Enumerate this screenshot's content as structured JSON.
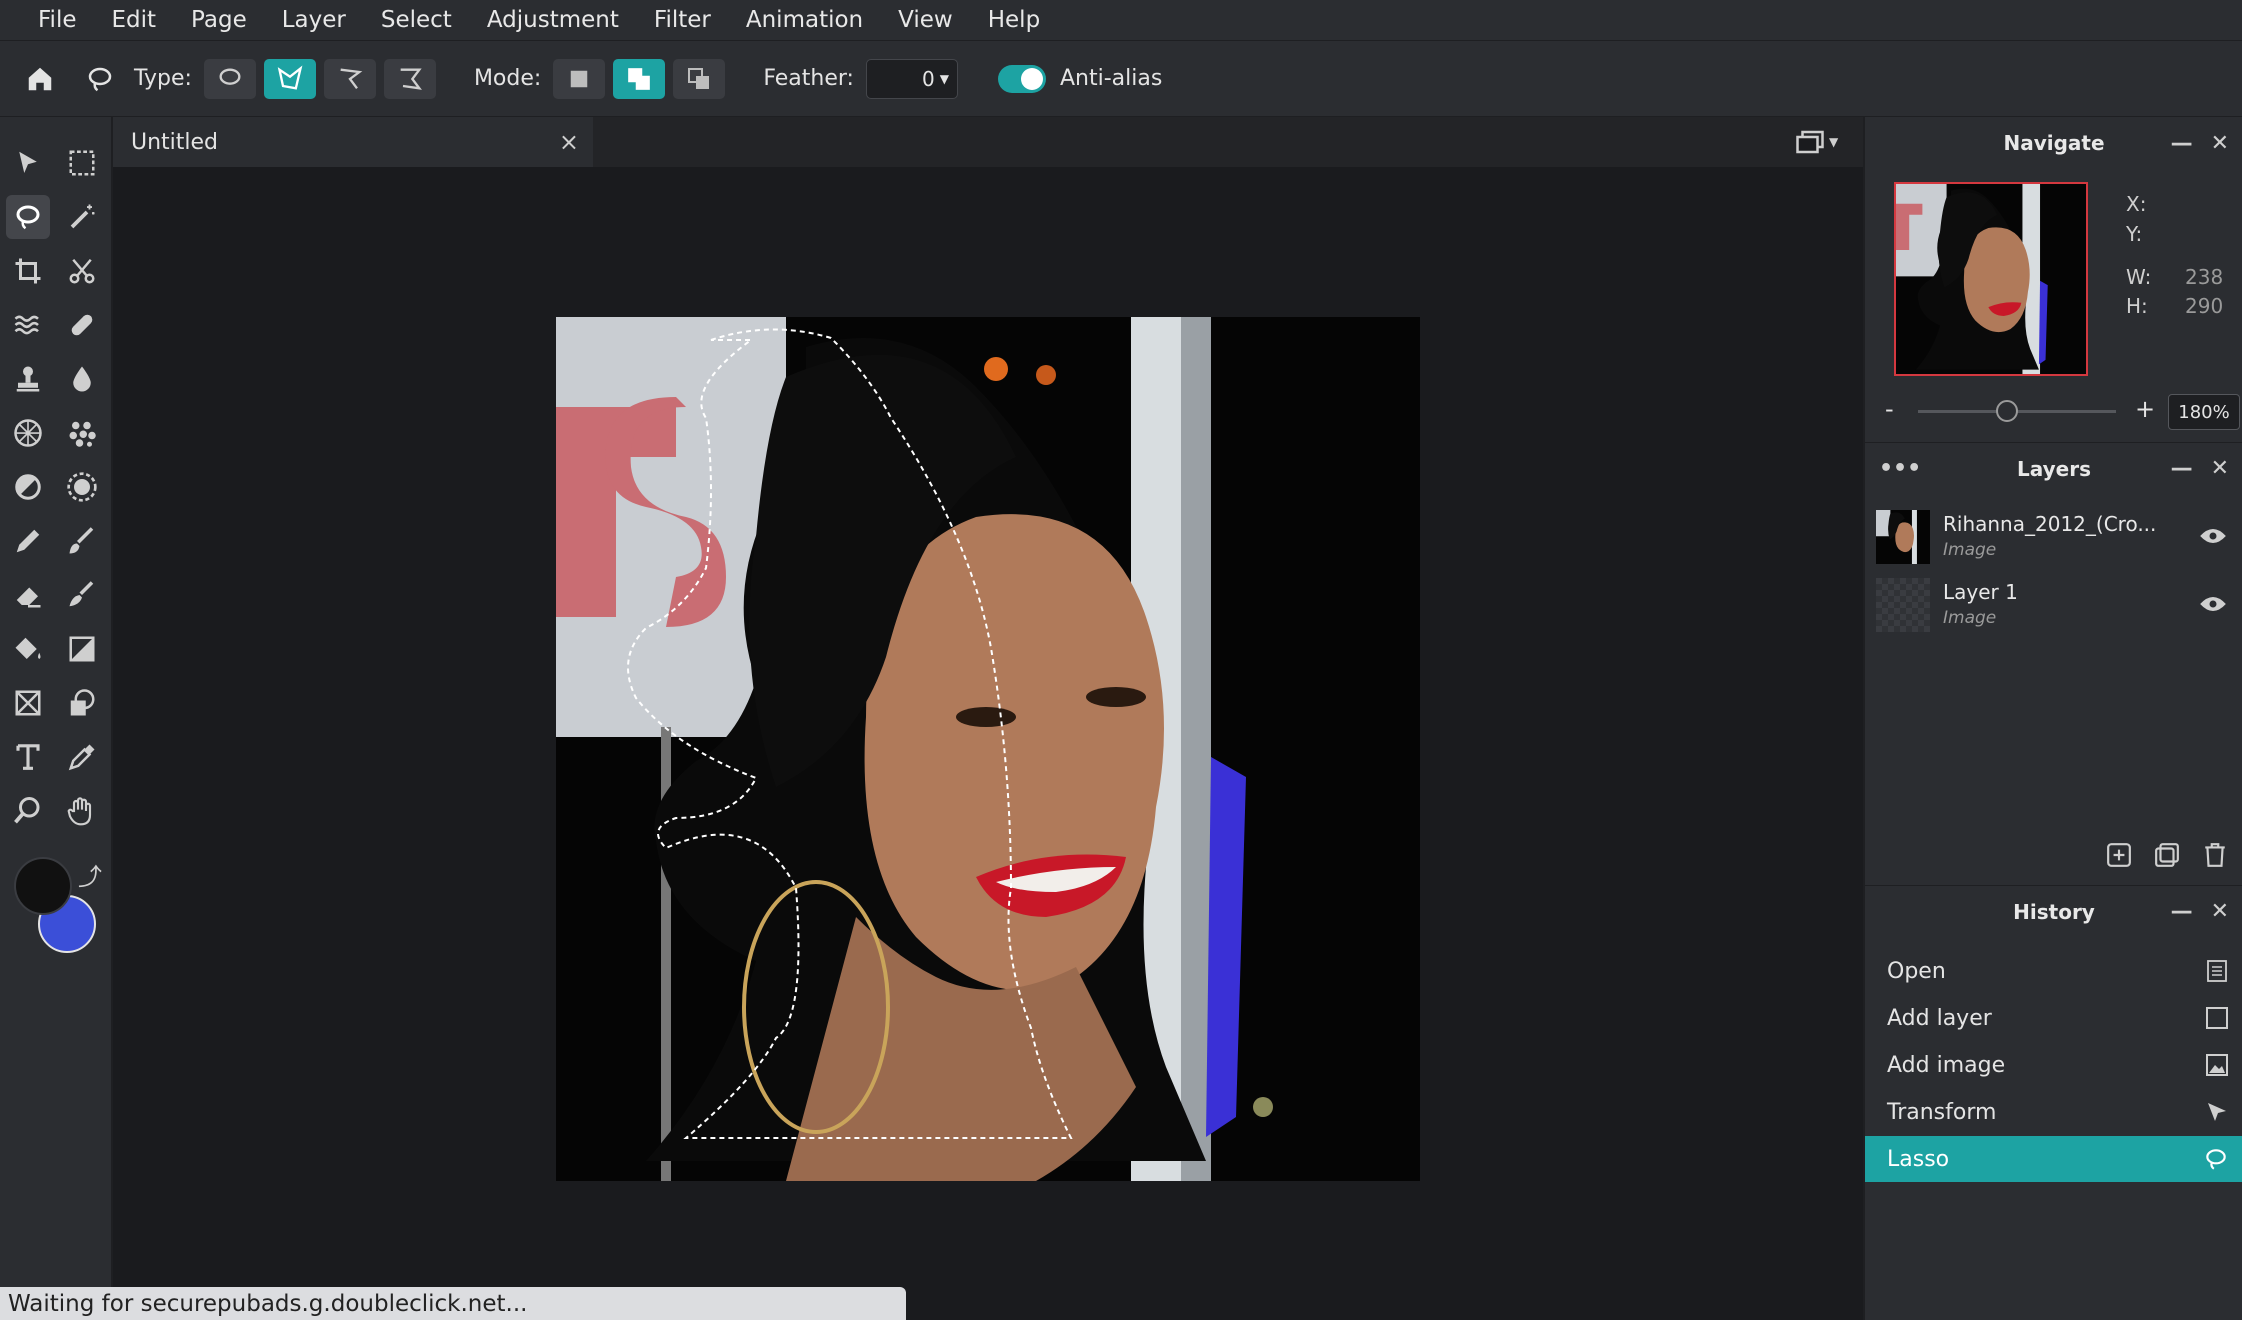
{
  "menu": [
    "File",
    "Edit",
    "Page",
    "Layer",
    "Select",
    "Adjustment",
    "Filter",
    "Animation",
    "View",
    "Help"
  ],
  "options": {
    "type_label": "Type:",
    "mode_label": "Mode:",
    "feather_label": "Feather:",
    "feather_value": "0",
    "antialias_label": "Anti-alias",
    "accent": "#1da3a3"
  },
  "document": {
    "tab_title": "Untitled",
    "close": "×"
  },
  "navigate": {
    "title": "Navigate",
    "x_label": "X:",
    "y_label": "Y:",
    "w_label": "W:",
    "h_label": "H:",
    "w_value": "238",
    "h_value": "290",
    "zoom_minus": "-",
    "zoom_plus": "+",
    "zoom_value": "180%",
    "zoom_fraction": 0.45
  },
  "layers": {
    "title": "Layers",
    "items": [
      {
        "name": "Rihanna_2012_(Cro...",
        "type": "Image"
      },
      {
        "name": "Layer 1",
        "type": "Image"
      }
    ]
  },
  "history": {
    "title": "History",
    "items": [
      {
        "label": "Open",
        "icon": "document-icon"
      },
      {
        "label": "Add layer",
        "icon": "square-icon"
      },
      {
        "label": "Add image",
        "icon": "image-icon"
      },
      {
        "label": "Transform",
        "icon": "pointer-icon"
      },
      {
        "label": "Lasso",
        "icon": "lasso-icon"
      }
    ]
  },
  "colors": {
    "foreground": "#111111",
    "background": "#3b4fd8"
  },
  "status": "Waiting for securepubads.g.doubleclick.net..."
}
